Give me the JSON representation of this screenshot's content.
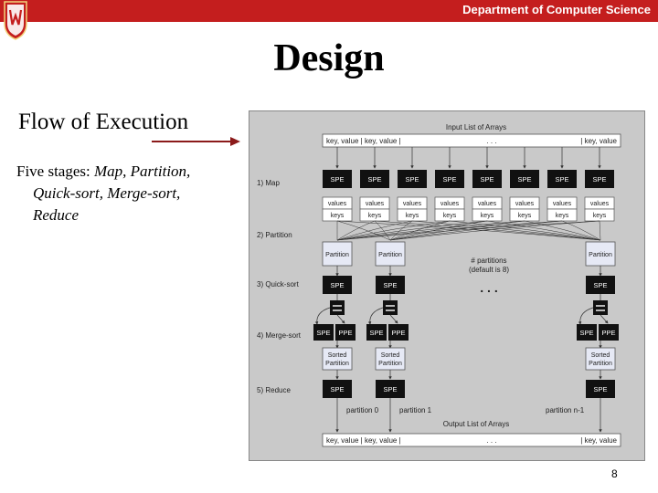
{
  "header": {
    "department": "Department of Computer Science",
    "brand_color": "#c41e1e"
  },
  "slide": {
    "title": "Design",
    "subtitle": "Flow of Execution",
    "stages_intro": "Five stages:",
    "stages_line1": "Map, Partition,",
    "stages_line2": "Quick-sort, Merge-sort,",
    "stages_line3": "Reduce",
    "page_number": "8"
  },
  "figure": {
    "input_title": "Input List of Arrays",
    "input_row_left": "key, value | key, value |",
    "input_row_mid": ". . .",
    "input_row_right": "| key, value",
    "stage_1": "1) Map",
    "stage_2": "2) Partition",
    "stage_3": "3) Quick-sort",
    "stage_4": "4) Merge-sort",
    "stage_5": "5) Reduce",
    "spe": "SPE",
    "ppe": "PPE",
    "values": "values",
    "keys": "keys",
    "partition": "Partition",
    "sorted_partition_1": "Sorted",
    "sorted_partition_2": "Partition",
    "num_partitions_1": "# partitions",
    "num_partitions_2": "(default is 8)",
    "dots": ". . .",
    "partition_0": "partition 0",
    "partition_1": "partition 1",
    "partition_n": "partition n-1",
    "output_title": "Output List of Arrays",
    "output_row_left": "key, value | key, value |",
    "output_row_mid": ". . .",
    "output_row_right": "| key, value",
    "icons": [
      "crest-icon",
      "arrow-right-icon"
    ]
  }
}
